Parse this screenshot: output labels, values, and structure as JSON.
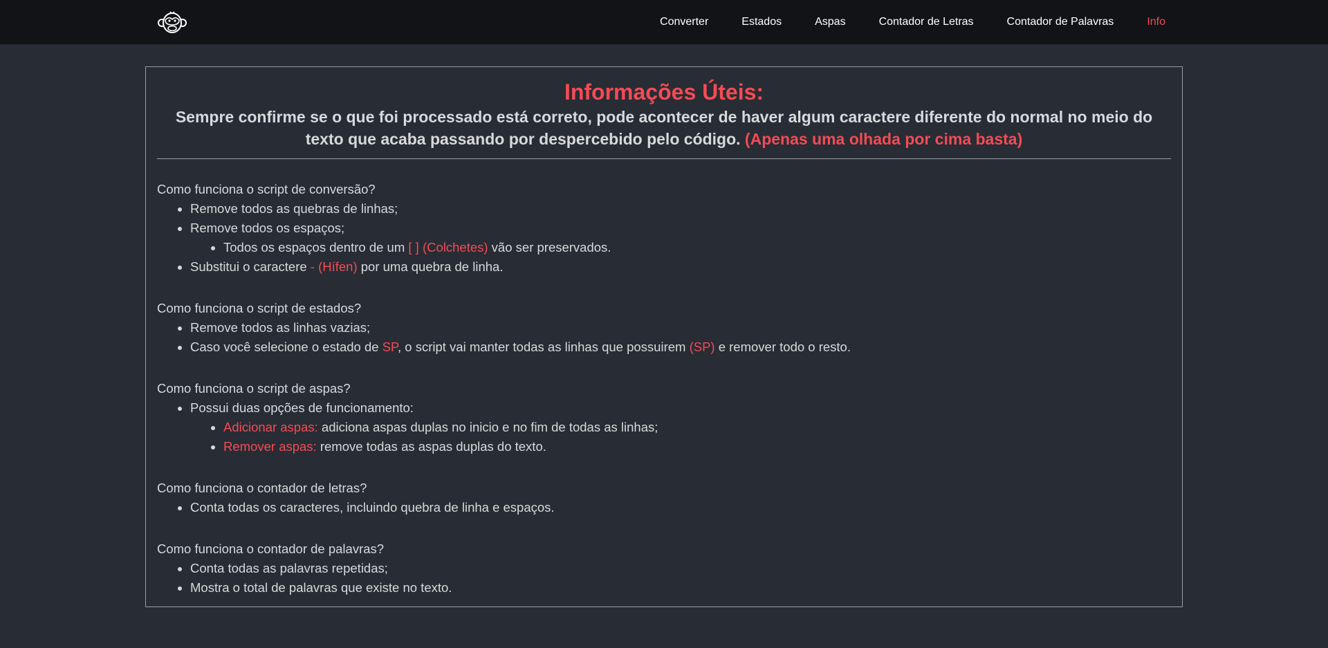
{
  "nav": {
    "logo_icon": "monkey-logo-icon",
    "links": [
      "Converter",
      "Estados",
      "Aspas",
      "Contador de Letras",
      "Contador de Palavras",
      "Info"
    ],
    "active": "Info",
    "accent_color": "#f44b55"
  },
  "card": {
    "title": "Informações Úteis:",
    "subtitle": "Sempre confirme se o que foi processado está correto, pode acontecer de haver algum caractere diferente do normal no meio do texto que acaba passando por despercebido pelo código.",
    "subtitle_highlight": "(Apenas uma olhada por cima basta)"
  },
  "sections": {
    "conversao": {
      "question": "Como funciona o script de conversão?",
      "item1": "Remove todos as quebras de linhas;",
      "item2": "Remove todos os espaços;",
      "item2_sub_pre": "Todos os espaços dentro de um ",
      "item2_sub_hl": "[ ] (Colchetes)",
      "item2_sub_post": " vão ser preservados.",
      "item3_pre": "Substitui o caractere ",
      "item3_hl": "- (Hífen)",
      "item3_post": " por uma quebra de linha."
    },
    "estados": {
      "question": "Como funciona o script de estados?",
      "item1": "Remove todos as linhas vazias;",
      "item2_pre": "Caso você selecione o estado de ",
      "item2_hl1": "SP",
      "item2_mid": ", o script vai manter todas as linhas que possuirem ",
      "item2_hl2": "(SP)",
      "item2_post": " e remover todo o resto."
    },
    "aspas": {
      "question": "Como funciona o script de aspas?",
      "item1": "Possui duas opções de funcionamento:",
      "sub1_hl": "Adicionar aspas:",
      "sub1_text": " adiciona aspas duplas no inicio e no fim de todas as linhas;",
      "sub2_hl": "Remover aspas:",
      "sub2_text": " remove todas as aspas duplas do texto."
    },
    "letras": {
      "question": "Como funciona o contador de letras?",
      "item1": "Conta todas os caracteres, incluindo quebra de linha e espaços."
    },
    "palavras": {
      "question": "Como funciona o contador de palavras?",
      "item1": "Conta todas as palavras repetidas;",
      "item2": "Mostra o total de palavras que existe no texto."
    }
  }
}
